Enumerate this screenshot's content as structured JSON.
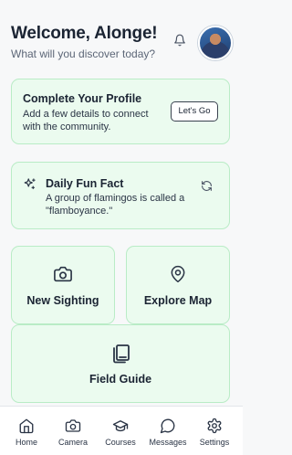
{
  "header": {
    "title": "Welcome, Alonge!",
    "subtitle": "What will you discover today?",
    "bell_icon": "bell-icon",
    "avatar": "user-avatar"
  },
  "profile_card": {
    "title": "Complete Your Profile",
    "description": "Add a few details to connect with the community.",
    "button_label": "Let's Go"
  },
  "fun_fact": {
    "title": "Daily Fun Fact",
    "text": "A group of flamingos is called a \"flamboyance.\"",
    "icon": "sparkle-icon",
    "refresh_icon": "refresh-icon"
  },
  "tiles": [
    {
      "label": "New Sighting",
      "icon": "camera-icon"
    },
    {
      "label": "Explore Map",
      "icon": "map-pin-icon"
    },
    {
      "label": "Field Guide",
      "icon": "book-icon"
    }
  ],
  "nav": [
    {
      "label": "Home",
      "icon": "home-icon"
    },
    {
      "label": "Camera",
      "icon": "camera-icon"
    },
    {
      "label": "Courses",
      "icon": "graduation-cap-icon"
    },
    {
      "label": "Messages",
      "icon": "message-icon"
    },
    {
      "label": "Settings",
      "icon": "gear-icon"
    }
  ],
  "colors": {
    "card_background": "#ebfbef",
    "card_border": "#b9ecc6",
    "text_primary": "#1b2433",
    "text_secondary": "#5c6677"
  }
}
